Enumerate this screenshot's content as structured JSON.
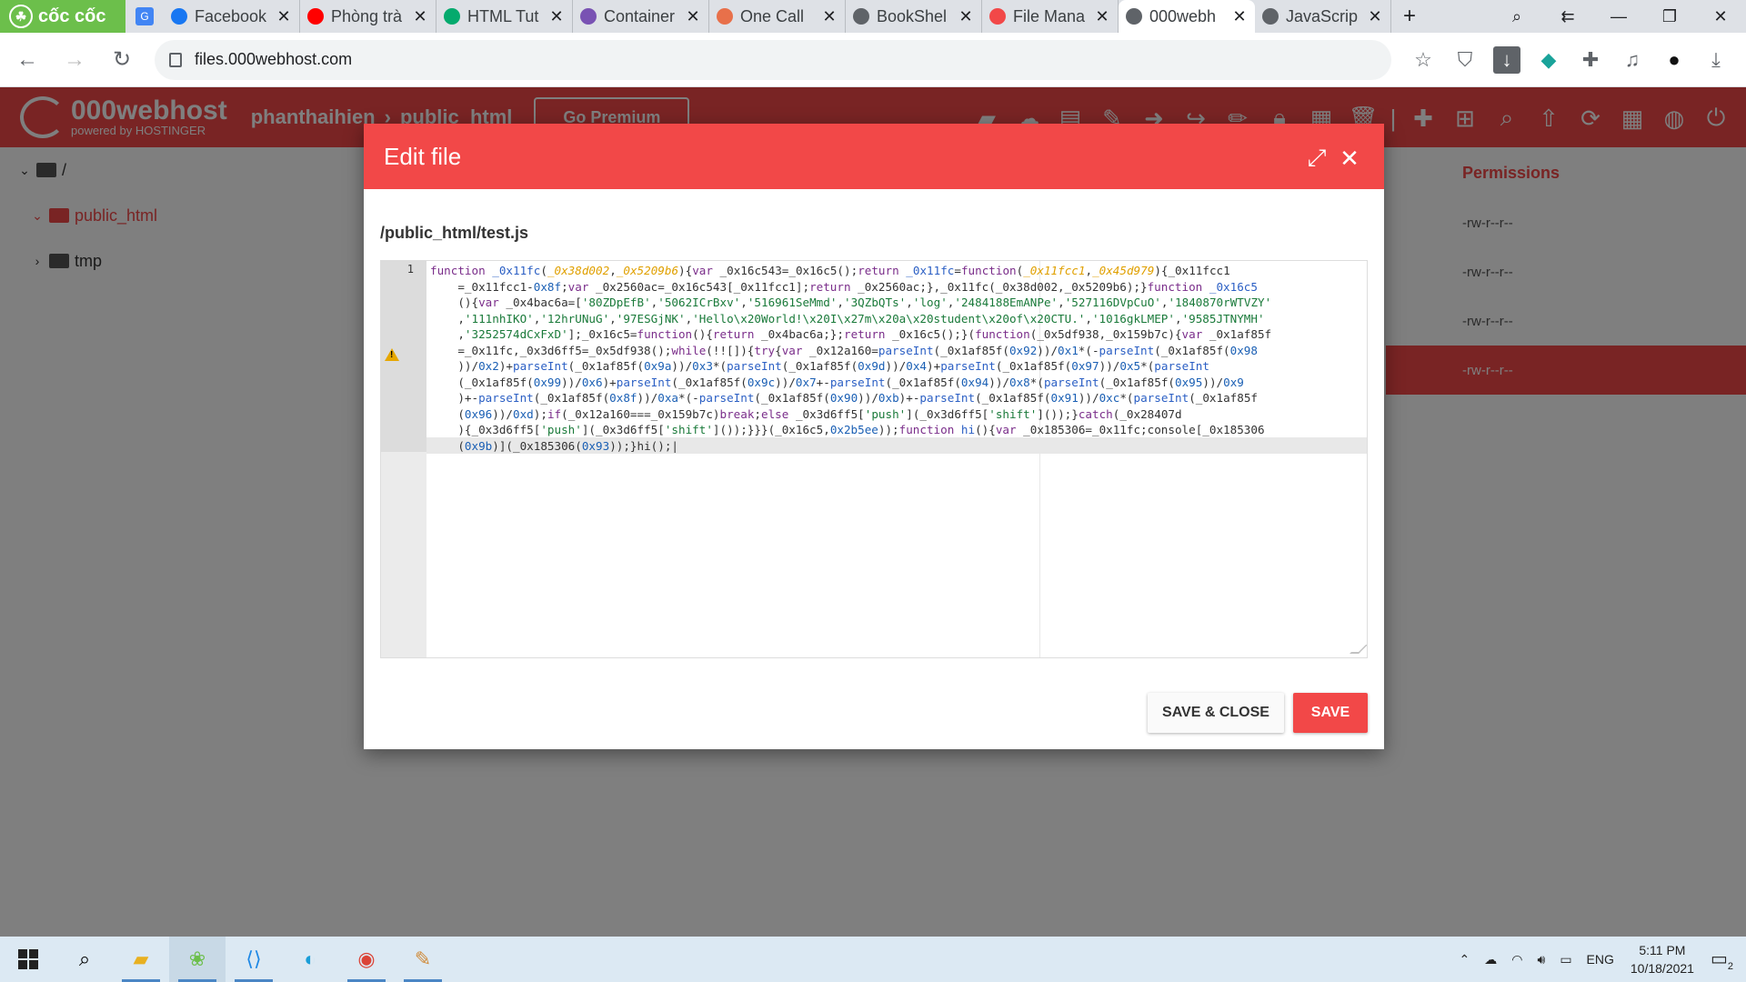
{
  "browser": {
    "brand": "cốc cốc",
    "tabs": [
      {
        "title": "Facebook",
        "icon": "facebook-icon",
        "color": "#1877f2"
      },
      {
        "title": "Phòng trà",
        "icon": "youtube-icon",
        "color": "#ff0000"
      },
      {
        "title": "HTML Tut",
        "icon": "w3-icon",
        "color": "#04aa6d"
      },
      {
        "title": "Container",
        "icon": "bootstrap-icon",
        "color": "#7952b3"
      },
      {
        "title": "One Call",
        "icon": "onecall-icon",
        "color": "#e8704a"
      },
      {
        "title": "BookShel",
        "icon": "globe-icon",
        "color": "#5f6368"
      },
      {
        "title": "File Mana",
        "icon": "webhost-icon",
        "color": "#f24848"
      },
      {
        "title": "000webh",
        "icon": "globe-icon",
        "color": "#5f6368"
      },
      {
        "title": "JavaScrip",
        "icon": "globe-icon",
        "color": "#5f6368"
      }
    ],
    "url": "files.000webhost.com"
  },
  "app": {
    "logo_name": "000webhost",
    "logo_sub": "powered by HOSTINGER",
    "breadcrumb": [
      "phanthaihien",
      "public_html"
    ],
    "premium": "Go Premium",
    "tree": {
      "root": "/",
      "items": [
        "public_html",
        "tmp"
      ]
    },
    "permissions": {
      "header": "Permissions",
      "rows": [
        "-rw-r--r--",
        "-rw-r--r--",
        "-rw-r--r--",
        "-rw-r--r--"
      ]
    }
  },
  "modal": {
    "title": "Edit file",
    "path": "/public_html/test.js",
    "line_number": "1",
    "save_close": "SAVE & CLOSE",
    "save": "SAVE"
  },
  "taskbar": {
    "lang": "ENG",
    "time": "5:11 PM",
    "date": "10/18/2021",
    "notifications": "2"
  }
}
